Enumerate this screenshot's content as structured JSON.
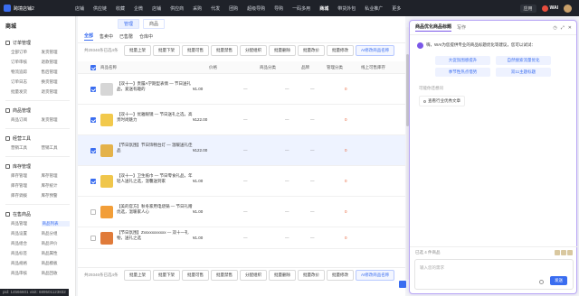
{
  "topbar": {
    "brand": "跨境店铺2",
    "nav": [
      "店铺",
      "供应链",
      "收藏",
      "企微",
      "店铺",
      "供应商",
      "采购",
      "代发",
      "团购",
      "超级导购",
      "导购",
      "一码多用",
      "商城",
      "带货外包",
      "私业推广",
      "更多"
    ],
    "active_index": 12,
    "store_btn": "应用",
    "wai": "WAI"
  },
  "sidebar": {
    "title": "商城",
    "groups": [
      {
        "label": "订单管理",
        "items": [
          "全部订单",
          "发货管理",
          "订单审核",
          "退款管理",
          "物流追踪",
          "售后管理",
          "订单日志",
          "换货管理",
          "批量发货",
          "退货管理"
        ]
      },
      {
        "label": "商品管理",
        "items": [
          "商品订阅",
          "发货管理"
        ]
      },
      {
        "label": "经营工具",
        "items": [
          "营销工具",
          "营销工具"
        ]
      },
      {
        "label": "库存管理",
        "items": [
          "库存管理",
          "库存管理",
          "库存管理",
          "库存统计",
          "库存调拨",
          "库存预警"
        ]
      },
      {
        "label": "在售商品",
        "items": [
          "商品管理",
          "商品列表",
          "商品设置",
          "商品分组",
          "商品组合",
          "商品评价",
          "商品标签",
          "商品属性",
          "商品规格",
          "商品模板",
          "商品审核",
          "商品回收"
        ]
      }
    ]
  },
  "main": {
    "page_tabs": [
      "管理",
      "商品"
    ],
    "filter_tabs": [
      "全部",
      "售卖中",
      "已售罄",
      "仓库中"
    ],
    "toolbar": {
      "selected_text": "共29346条已选4条",
      "buttons": [
        "批量上架",
        "批量下架",
        "批量可售",
        "批量禁售",
        "分配组织",
        "批量删除",
        "批量改价",
        "批量修改"
      ],
      "ai_button": "AI修改商品名称"
    },
    "columns": [
      "商品名称",
      "价格",
      "商品分类",
      "品牌",
      "管理分类",
      "线上可售库存"
    ],
    "rows": [
      {
        "name": "【双十一】贵履A学期型表情 — 节日送礼品，爱送有趣的",
        "price": "¥1.00",
        "category": "—",
        "brand": "—",
        "mgmt": "—",
        "stock": "0",
        "checked": true,
        "color": "#d6d6d6",
        "highlight": false
      },
      {
        "name": "【双十一】优雅眼镜 — 节日送礼之选，高贵时尚魅力",
        "price": "¥122.00",
        "category": "—",
        "brand": "—",
        "mgmt": "—",
        "stock": "0",
        "checked": true,
        "color": "#f2c94c",
        "highlight": false
      },
      {
        "name": "【节日氛围】节日饰物台灯 — 温暖送礼佳品",
        "price": "¥122.00",
        "category": "—",
        "brand": "—",
        "mgmt": "—",
        "stock": "0",
        "checked": true,
        "color": "#e4b24a",
        "highlight": true
      },
      {
        "name": "【双十一】卫生纸巾 — 节日零食礼品，年轻人送礼之选，温馨送到家",
        "price": "¥1.00",
        "category": "—",
        "brand": "—",
        "mgmt": "—",
        "stock": "0",
        "checked": true,
        "color": "#f0c64b",
        "highlight": false
      },
      {
        "name": "【美的官方】秋冬家用电烧锅 — 节日礼赠优选，温暖家人心",
        "price": "¥1.00",
        "category": "—",
        "brand": "—",
        "mgmt": "—",
        "stock": "0",
        "checked": false,
        "color": "#f29e38",
        "highlight": false
      },
      {
        "name": "【节日氛围】Zxsxxxxxxxxx — 双十一礼物，送礼之选",
        "price": "¥1.00",
        "category": "—",
        "brand": "—",
        "mgmt": "—",
        "stock": "0",
        "checked": false,
        "color": "#e07b3a",
        "highlight": false
      }
    ],
    "bottom_bar": {
      "selected_text": "共29346条已选4条",
      "buttons": [
        "批量上架",
        "批量下架",
        "批量可售",
        "批量禁售",
        "分配组织",
        "批量删除",
        "批量改价",
        "批量修改"
      ],
      "ai_button": "AI修改商品名称"
    }
  },
  "panel": {
    "tabs": [
      "商品优化商品标题",
      "写作"
    ],
    "greeting": "嗨，WAI为您提供专业的商品标题优化等建议，您可以试试：",
    "chips": [
      "大促氛围感提升",
      "自然搜索流量优化",
      "季节性热点借势",
      "双11主题标题"
    ],
    "ask_label": "可能你还想问",
    "ask_items": [
      "查看行业优秀文章"
    ],
    "selected_count": "已选 4 件商品",
    "input_placeholder": "输入您的需求",
    "send_label": "发送"
  },
  "statusbar": "pid: 14566601 visit: 689501123832"
}
